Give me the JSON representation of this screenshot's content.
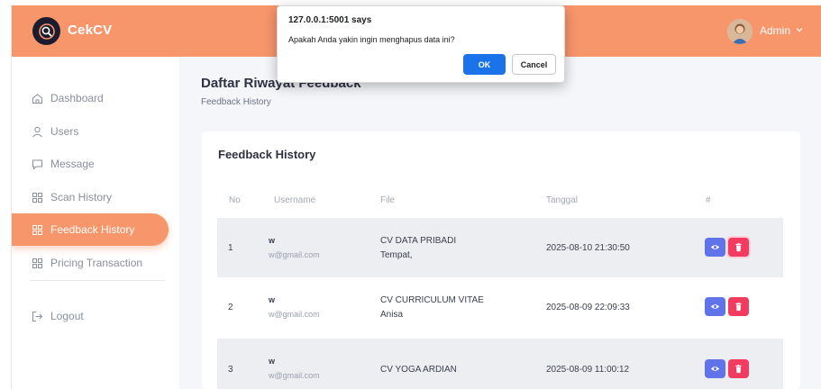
{
  "header": {
    "brand": "CekCV",
    "user_name": "Admin",
    "accent_color": "#f7956b"
  },
  "sidebar": {
    "items": [
      {
        "label": "Dashboard",
        "icon": "home-icon",
        "active": false
      },
      {
        "label": "Users",
        "icon": "user-icon",
        "active": false
      },
      {
        "label": "Message",
        "icon": "message-icon",
        "active": false
      },
      {
        "label": "Scan History",
        "icon": "grid-icon",
        "active": false
      },
      {
        "label": "Feedback History",
        "icon": "grid-icon",
        "active": true
      },
      {
        "label": "Pricing Transaction",
        "icon": "grid-icon",
        "active": false
      }
    ],
    "logout_label": "Logout"
  },
  "page": {
    "title": "Daftar Riwayat Feedback",
    "breadcrumb": "Feedback History"
  },
  "card": {
    "title": "Feedback History",
    "columns": [
      "No",
      "Username",
      "File",
      "Tanggal",
      "#"
    ],
    "rows": [
      {
        "no": "1",
        "username": "w",
        "email": "w@gmail.com",
        "file_title": "CV DATA PRIBADI",
        "file_sub": "Tempat,",
        "date": "2025-08-10 21:30:50"
      },
      {
        "no": "2",
        "username": "w",
        "email": "w@gmail.com",
        "file_title": "CV CURRICULUM VITAE",
        "file_sub": "Anisa",
        "date": "2025-08-09 22:09:33"
      },
      {
        "no": "3",
        "username": "w",
        "email": "w@gmail.com",
        "file_title": "CV YOGA ARDIAN",
        "file_sub": "",
        "date": "2025-08-09 11:00:12"
      }
    ]
  },
  "dialog": {
    "title": "127.0.0.1:5001 says",
    "message": "Apakah Anda yakin ingin menghapus data ini?",
    "ok_label": "OK",
    "cancel_label": "Cancel"
  }
}
